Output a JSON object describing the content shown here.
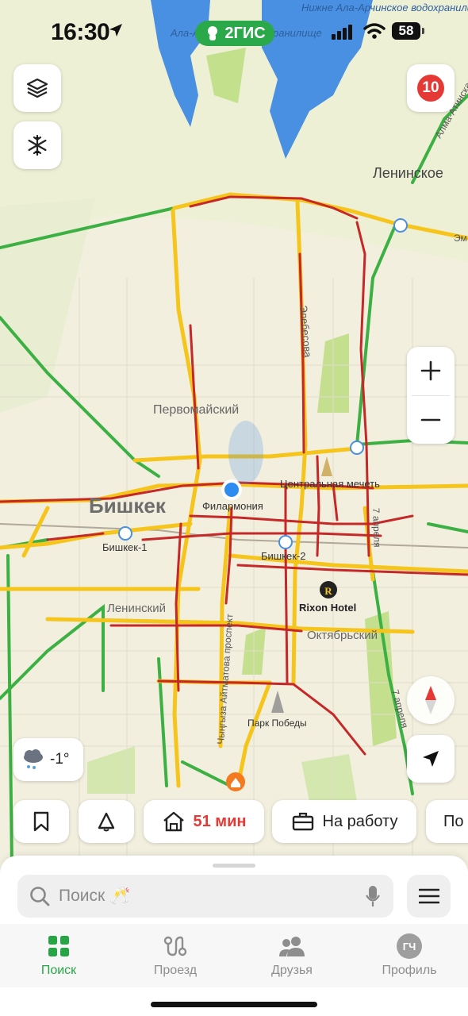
{
  "status_bar": {
    "time": "16:30",
    "battery": "58",
    "brand": "2ГИС"
  },
  "map": {
    "labels": {
      "reservoir_left": "Ала-Арчинское водохранилище",
      "reservoir_right": "Нижне Ала-Арчинское водохранилище",
      "alma_ata_road": "Алма-Атинская",
      "leninskoe": "Ленинское",
      "pervomaisky": "Первомайский",
      "bishkek": "Бишкек",
      "philharmonia": "Филармония",
      "central_mosque": "Центральная мечеть",
      "bishkek1": "Бишкек-1",
      "bishkek2": "Бишкек-2",
      "rixon": "Rixon Hotel",
      "leninsky": "Ленинский",
      "oktyabrsky": "Октябрьский",
      "park_pobedy": "Парк Победы",
      "elebesova": "Элебесова",
      "aitmatov": "Чыңгыза Айтматова проспект",
      "apr7_a": "7 апреля",
      "apr7_b": "7 апреля",
      "em": "Эм"
    },
    "colors": {
      "jam": "#c62828",
      "slow": "#f5c51b",
      "free": "#3cb043",
      "water": "#4a90e2",
      "green_area": "#a8d26a"
    }
  },
  "controls": {
    "layers_icon": "layers-icon",
    "snow_icon": "snowflake-icon",
    "notifications_count": "10",
    "zoom_in": "+",
    "zoom_out": "−",
    "weather_temp": "-1°"
  },
  "quick_chips": {
    "home_time": "51 мин",
    "to_work": "На работу",
    "partial": "По"
  },
  "search": {
    "placeholder": "Поиск 🥂"
  },
  "tabs": [
    {
      "label": "Поиск",
      "icon": "grid-icon",
      "active": true
    },
    {
      "label": "Проезд",
      "icon": "route-icon",
      "active": false
    },
    {
      "label": "Друзья",
      "icon": "friends-icon",
      "active": false
    },
    {
      "label": "Профиль",
      "avatar": "ГЧ",
      "active": false
    }
  ]
}
